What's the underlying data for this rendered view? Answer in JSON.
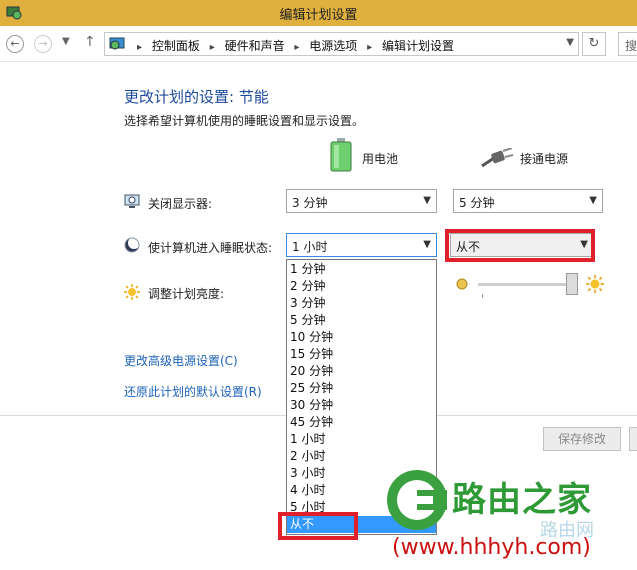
{
  "window": {
    "title": "编辑计划设置"
  },
  "address_bar": {
    "crumbs": [
      "控制面板",
      "硬件和声音",
      "电源选项",
      "编辑计划设置"
    ],
    "search_placeholder": "搜"
  },
  "page": {
    "heading": "更改计划的设置: 节能",
    "subheading": "选择希望计算机使用的睡眠设置和显示设置。",
    "col_battery": "用电池",
    "col_plugged": "接通电源"
  },
  "settings": {
    "display_off": {
      "label": "关闭显示器:",
      "battery": "3 分钟",
      "plugged": "5 分钟"
    },
    "sleep": {
      "label": "使计算机进入睡眠状态:",
      "battery": "1 小时",
      "plugged": "从不"
    },
    "brightness": {
      "label": "调整计划亮度:"
    }
  },
  "dropdown": {
    "options": [
      "1 分钟",
      "2 分钟",
      "3 分钟",
      "5 分钟",
      "10 分钟",
      "15 分钟",
      "20 分钟",
      "25 分钟",
      "30 分钟",
      "45 分钟",
      "1 小时",
      "2 小时",
      "3 小时",
      "4 小时",
      "5 小时",
      "从不"
    ],
    "selected": "从不"
  },
  "links": {
    "advanced": "更改高级电源设置(C)",
    "restore": "还原此计划的默认设置(R)"
  },
  "buttons": {
    "save": "保存修改"
  },
  "watermark": {
    "brand": "路由之家",
    "sub": "路由网",
    "url": "(www.hhhyh.com)"
  },
  "colors": {
    "titlebar": "#e0b03f",
    "accent": "#1c4a9a",
    "link": "#1c63b8",
    "highlight": "#e0202a",
    "selection": "#3399ff"
  },
  "icons": [
    "app-icon",
    "back-icon",
    "forward-icon",
    "up-icon",
    "control-panel-icon",
    "refresh-icon",
    "battery-icon",
    "plug-icon",
    "monitor-icon",
    "sleep-moon-icon",
    "brightness-sun-icon",
    "router-logo-icon"
  ]
}
